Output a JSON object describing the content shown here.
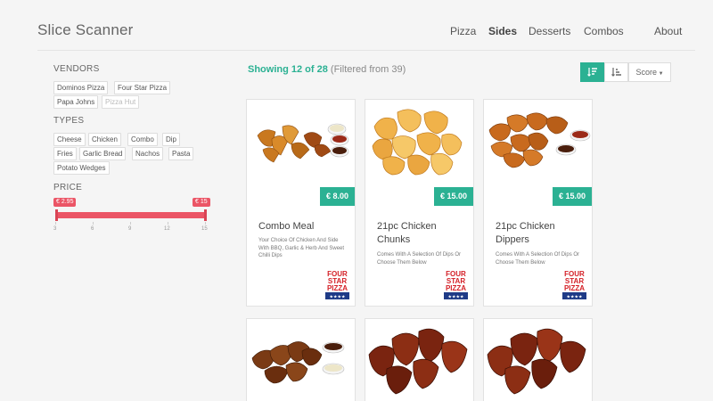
{
  "app": {
    "title": "Slice Scanner"
  },
  "nav": {
    "pizza": "Pizza",
    "sides": "Sides",
    "desserts": "Desserts",
    "combos": "Combos",
    "about": "About",
    "active": "Sides"
  },
  "sidebar": {
    "vendors_title": "VENDORS",
    "vendors": [
      "Dominos Pizza",
      "Four Star Pizza",
      "Papa Johns",
      "Pizza Hut"
    ],
    "types_title": "TYPES",
    "types": [
      "Cheese",
      "Chicken",
      "Combo",
      "Dip",
      "Fries",
      "Garlic Bread",
      "Nachos",
      "Pasta",
      "Potato Wedges"
    ],
    "price_title": "PRICE",
    "price_min_label": "€ 2.95",
    "price_max_label": "€ 15",
    "price_ticks": [
      "3",
      "6",
      "9",
      "12",
      "15"
    ]
  },
  "results": {
    "showing_text": "Showing 12 of 28",
    "filtered_text": "(Filtered from 39)",
    "score_label": "Score",
    "sort_desc_active": true
  },
  "products": [
    {
      "price": "€ 8.00",
      "name": "Combo Meal",
      "desc": "Your Choice Of Chicken And Side With BBQ, Garlic & Herb And Sweet Chilli Dips"
    },
    {
      "price": "€ 15.00",
      "name": "21pc Chicken Chunks",
      "desc": "Comes With A Selection Of Dips Or Choose Them Below"
    },
    {
      "price": "€ 15.00",
      "name": "21pc Chicken Dippers",
      "desc": "Comes With A Selection Of Dips Or Choose Them Below"
    }
  ],
  "vendor_logo": {
    "line1": "FOUR",
    "line2": "STAR",
    "line3": "PIZZA"
  },
  "colors": {
    "accent": "#2bb193",
    "slider": "#eb5566",
    "logo_red": "#d42027",
    "logo_blue": "#1f3b87"
  }
}
